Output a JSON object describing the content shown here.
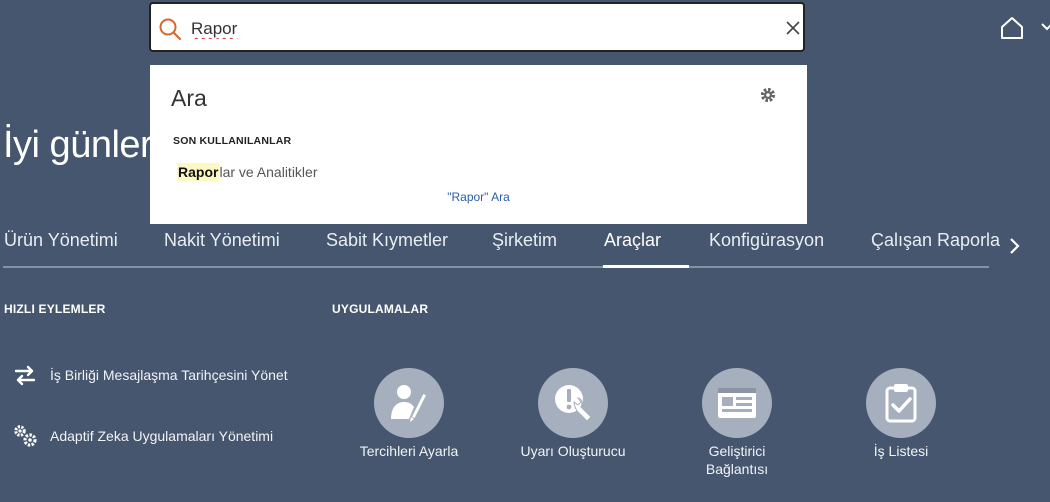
{
  "greeting": "İyi günler,",
  "header": {
    "home_icon": "home-icon",
    "menu_caret_icon": "caret-down-icon"
  },
  "tabs": [
    {
      "label": "Ürün Yönetimi"
    },
    {
      "label": "Nakit Yönetimi"
    },
    {
      "label": "Sabit Kıymetler"
    },
    {
      "label": "Şirketim"
    },
    {
      "label": "Araçlar",
      "active": true
    },
    {
      "label": "Konfigürasyon"
    },
    {
      "label": "Çalışan Raporla"
    }
  ],
  "quick_actions": {
    "title": "HIZLI EYLEMLER",
    "items": [
      {
        "label": "İş Birliği Mesajlaşma Tarihçesini Yönet",
        "icon": "swap-arrows-icon"
      },
      {
        "label": "Adaptif Zeka Uygulamaları Yönetimi",
        "icon": "gears-icon"
      }
    ]
  },
  "apps": {
    "title": "UYGULAMALAR",
    "items": [
      {
        "label": "Tercihleri Ayarla",
        "icon": "user-edit-icon"
      },
      {
        "label": "Uyarı Oluşturucu",
        "icon": "alert-wrench-icon"
      },
      {
        "label": "Geliştirici Bağlantısı",
        "icon": "developer-dashboard-icon"
      },
      {
        "label": "İş Listesi",
        "icon": "clipboard-check-icon"
      }
    ]
  },
  "search": {
    "value": "Rapor",
    "icon": "search-icon",
    "clear_icon": "close-icon"
  },
  "dropdown": {
    "title": "Ara",
    "section_label": "SON KULLANILANLAR",
    "result_match": "Rapor",
    "result_rest": "lar ve Analitikler",
    "search_link": "\"Rapor\" Ara",
    "settings_icon": "gear-icon"
  },
  "colors": {
    "background": "#45566e",
    "search_accent": "#d8662f",
    "link": "#2a5fa8",
    "app_circle": "#a6afbd"
  }
}
